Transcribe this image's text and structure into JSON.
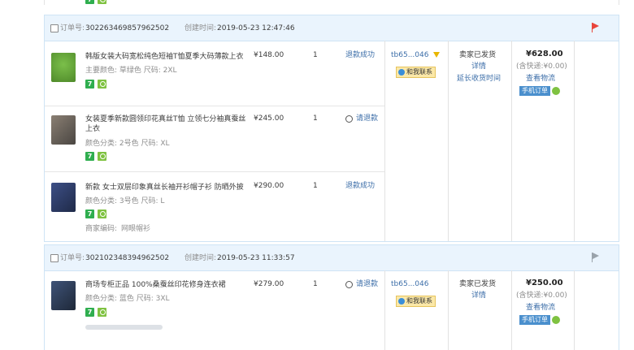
{
  "orders": [
    {
      "id_label": "订单号:",
      "id": "302263469857962502",
      "time_label": "创建时间:",
      "time": "2019-05-23 12:47:46",
      "seller": "tb65...046",
      "chat_label": "和我联系",
      "status": "卖家已发货",
      "detail": "详情",
      "extend": "延长收货时间",
      "total": "¥628.00",
      "shipping": "(含快递:¥0.00)",
      "logistics": "查看物流",
      "mobile": "手机订单",
      "flag_color": "#e8453c",
      "items": [
        {
          "title": "韩版女装大码宽松纯色短袖T恤夏季大码薄款上衣",
          "spec": "主要颜色: 草绿色  尺码: 2XL",
          "price": "¥148.00",
          "qty": "1",
          "refund": "退款成功",
          "thumb": "#5c9a35"
        },
        {
          "title": "女装夏季新款圆领印花真丝T恤 立领七分袖真蚕丝上衣",
          "spec": "颜色分类: 2号色  尺码: XL",
          "price": "¥245.00",
          "qty": "1",
          "refund": "请退款",
          "thumb": "#6a6560"
        },
        {
          "title": "新款 女士双层印象真丝长袖开衫帽子衫 防晒外披",
          "spec": "颜色分类: 3号色  尺码: L",
          "price": "¥290.00",
          "qty": "1",
          "refund": "退款成功",
          "thumb": "#2f3c6a",
          "code_label": "商家编码:",
          "code": "网眼帽衫"
        }
      ]
    },
    {
      "id_label": "订单号:",
      "id": "302102348394962502",
      "time_label": "创建时间:",
      "time": "2019-05-23 11:33:57",
      "seller": "tb65...046",
      "chat_label": "和我联系",
      "status": "卖家已发货",
      "detail": "详情",
      "total": "¥250.00",
      "shipping": "(含快递:¥0.00)",
      "logistics": "查看物流",
      "mobile": "手机订单",
      "flag_color": "#9aa3ab",
      "items": [
        {
          "title": "商场专柜正品 100%桑蚕丝印花修身连衣裙",
          "spec": "颜色分类: 蓝色  尺码: 3XL",
          "price": "¥279.00",
          "qty": "1",
          "refund": "请退款",
          "thumb": "#2e3e5c"
        }
      ]
    }
  ]
}
